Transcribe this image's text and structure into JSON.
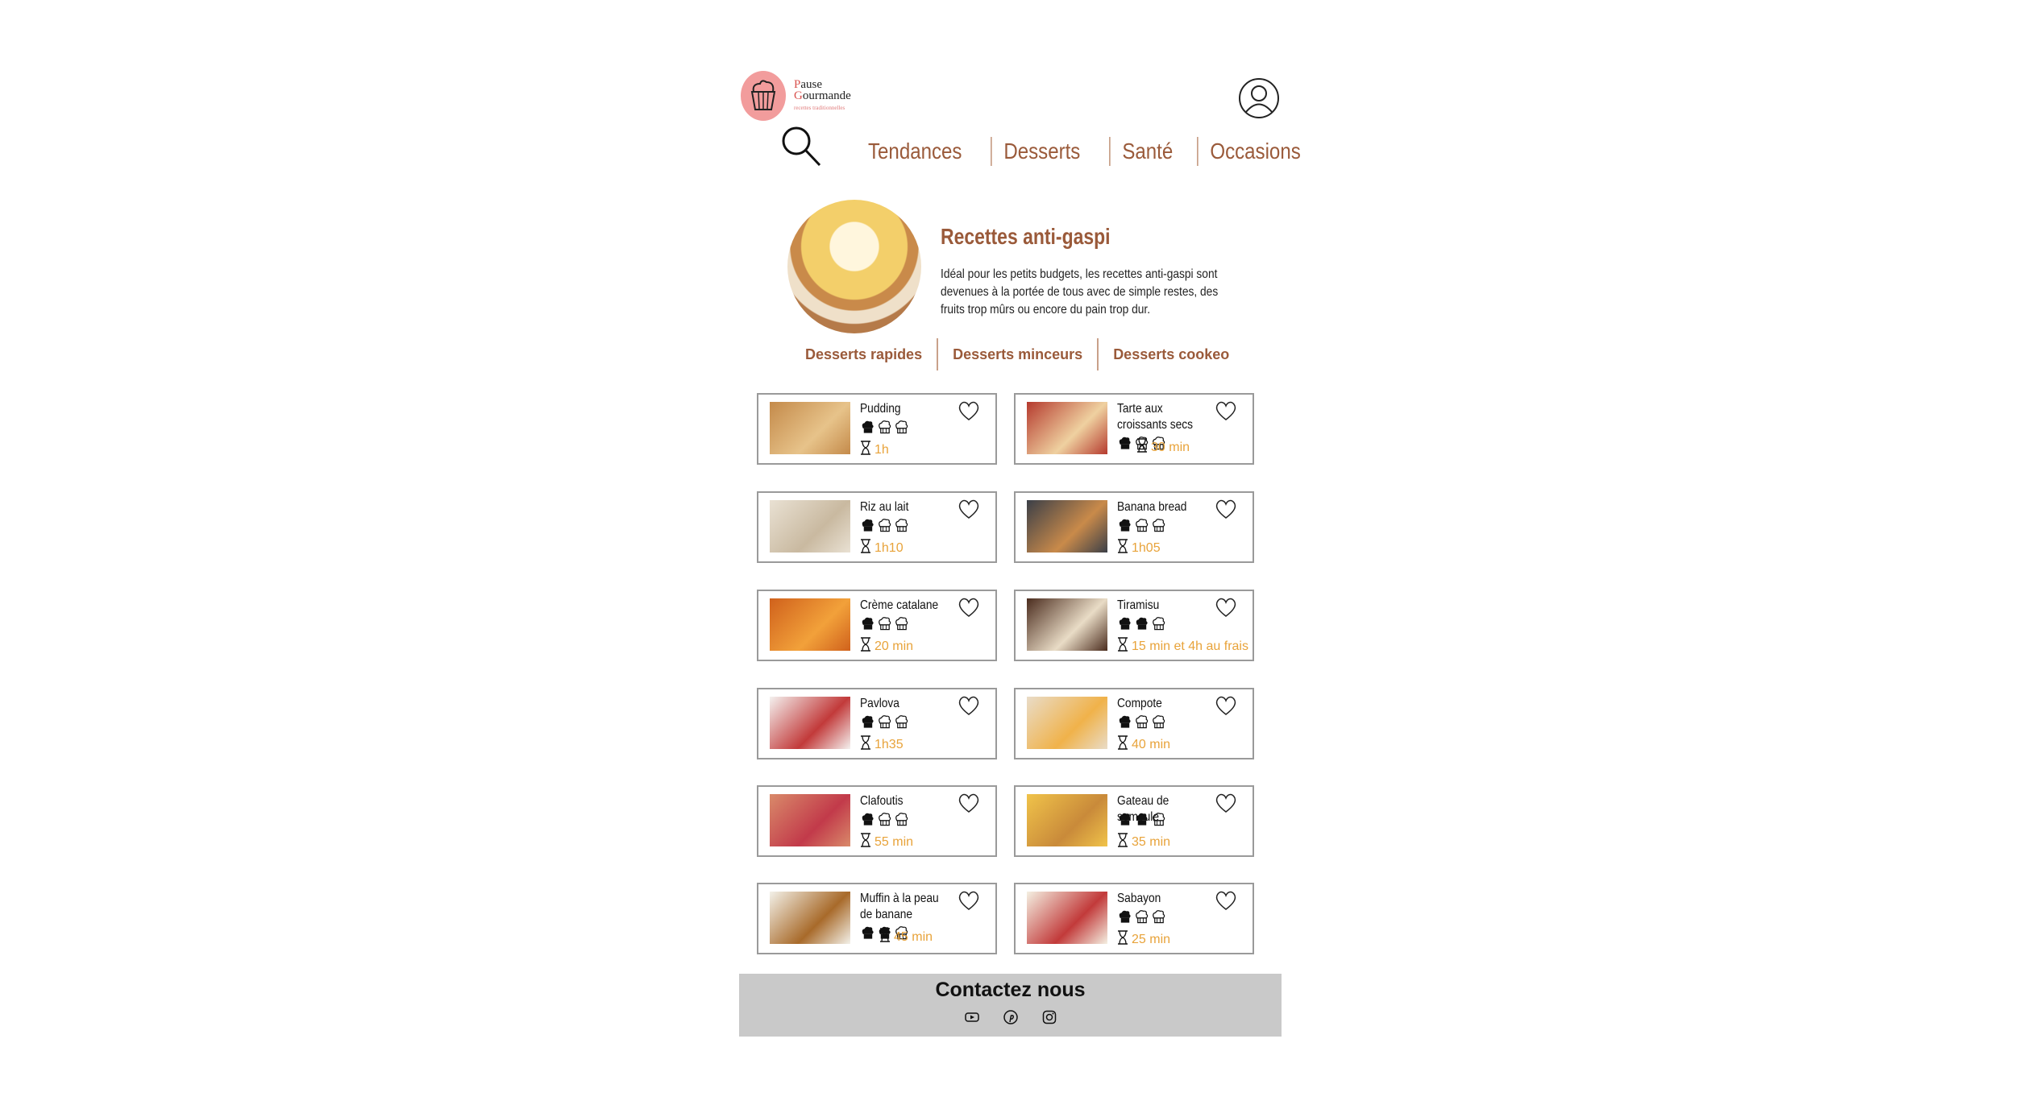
{
  "brand": {
    "name_line1_first": "P",
    "name_line1_rest": "ause",
    "name_line2_first": "G",
    "name_line2_rest": "ourmande",
    "tagline": "recettes traditionnelles",
    "accent": "#f29c9c"
  },
  "nav": [
    "Tendances",
    "Desserts",
    "Santé",
    "Occasions"
  ],
  "hero": {
    "title": "Recettes anti-gaspi",
    "description": "Idéal pour les petits budgets, les recettes anti-gaspi sont devenues à la portée de tous avec de simple restes, des fruits trop mûrs ou encore du pain trop dur."
  },
  "subnav": [
    "Desserts rapides",
    "Desserts minceurs",
    "Desserts cookeo"
  ],
  "recipes": [
    {
      "title": "Pudding",
      "difficulty": 1,
      "time": "1h"
    },
    {
      "title": "Tarte aux croissants secs",
      "difficulty": 1,
      "time": "30 min"
    },
    {
      "title": "Riz au lait",
      "difficulty": 1,
      "time": "1h10"
    },
    {
      "title": "Banana bread",
      "difficulty": 1,
      "time": "1h05"
    },
    {
      "title": "Crème catalane",
      "difficulty": 1,
      "time": "20 min"
    },
    {
      "title": "Tiramisu",
      "difficulty": 2,
      "time": "15 min et 4h au frais"
    },
    {
      "title": "Pavlova",
      "difficulty": 1,
      "time": "1h35"
    },
    {
      "title": "Compote",
      "difficulty": 1,
      "time": "40 min"
    },
    {
      "title": "Clafoutis",
      "difficulty": 1,
      "time": "55 min"
    },
    {
      "title": "Gateau de semoule",
      "difficulty": 2,
      "time": "35 min"
    },
    {
      "title": "Muffin à la peau de banane",
      "difficulty": 2,
      "time": "45 min"
    },
    {
      "title": "Sabayon",
      "difficulty": 1,
      "time": "25 min"
    }
  ],
  "footer": {
    "title": "Contactez nous",
    "social": [
      "youtube-icon",
      "pinterest-icon",
      "instagram-icon"
    ]
  },
  "colors": {
    "brown": "#9a5a3a",
    "orange_time": "#e8a33a",
    "footer_bg": "#c9c9c9"
  }
}
